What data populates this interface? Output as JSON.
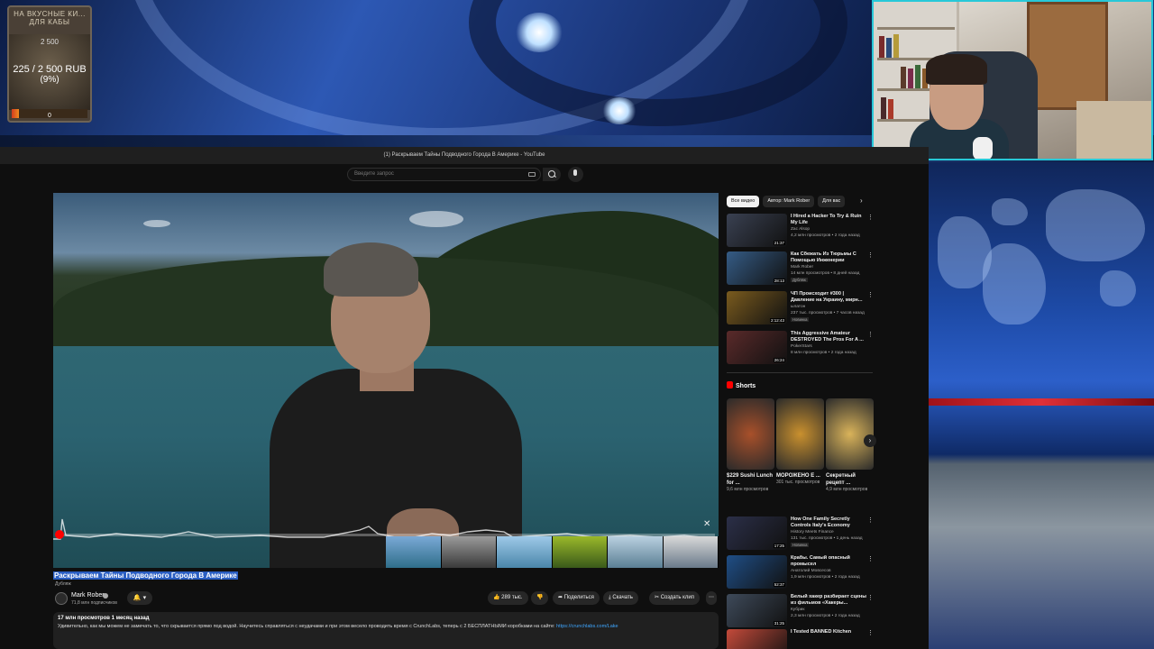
{
  "donation": {
    "header": "НА ВКУСНЫЕ КИ... ДЛЯ КАБЫ",
    "goal": "2 500",
    "amount": "225 / 2 500 RUB",
    "percent": "(9%)",
    "progress_fraction": 0.09,
    "bar_start": "0"
  },
  "browser": {
    "window_title": "(1) Раскрываем Тайны Подводного Города В Америке - YouTube"
  },
  "search": {
    "placeholder": "Введите запрос"
  },
  "video": {
    "title": "Раскрываем Тайны Подводного Города В Америке",
    "dubbed_label": "Дубляж",
    "progress_fraction": 0.01
  },
  "channel": {
    "name": "Mark Rober",
    "subscribers": "71,8 млн подписчиков"
  },
  "actions": {
    "likes": "289 тыс.",
    "share": "Поделиться",
    "download": "Скачать",
    "clip": "Создать клип",
    "more": "⋯"
  },
  "description": {
    "meta": "17 млн просмотров  1 месяц назад",
    "text": "Удивительно, как мы можем не замечать то, что скрывается прямо под водой. Научитесь справляться с неудачами и при этом весело проводить время с CrunchLabs, теперь с 2 БЕСПЛАТНЫМИ коробками на сайте: ",
    "link": "https://crunchlabs.com/Lake"
  },
  "chips": [
    "Все видео",
    "Автор: Mark Rober",
    "Для вас"
  ],
  "recommendations": [
    {
      "title": "I Hired a Hacker To Try & Ruin My Life",
      "channel": "Zac Alsop",
      "meta": "4,2 млн просмотров • 2 года назад",
      "duration": "21:37",
      "badge": "",
      "thumb_color": "#3a4152"
    },
    {
      "title": "Как Сбежать Из Тюрьмы С Помощью Инженерии",
      "channel": "Mark Rober",
      "meta": "14 млн просмотров • 8 дней назад",
      "duration": "28:13",
      "badge": "Дубляж",
      "thumb_color": "#355c86"
    },
    {
      "title": "ЧП Происходит #300 | Давление на Украину, мирн...",
      "channel": "ылатон",
      "meta": "237 тыс. просмотров • 7 часов назад",
      "duration": "2:12:43",
      "badge": "Новинка",
      "thumb_color": "#7a5b1e"
    },
    {
      "title": "This Aggressive Amateur DESTROYED The Pros For A ...",
      "channel": "PokerStars",
      "meta": "8 млн просмотров • 2 года назад",
      "duration": "26:24",
      "badge": "",
      "thumb_color": "#5a2a2a"
    }
  ],
  "shorts": {
    "heading": "Shorts",
    "items": [
      {
        "title": "$229 Sushi Lunch for ...",
        "views": "9,6 млн просмотров",
        "thumb_color": "#a8502a"
      },
      {
        "title": "МОРОЖЕНО Е ...",
        "views": "301 тыс. просмотров",
        "thumb_color": "#c9902e"
      },
      {
        "title": "Секретный рецепт ...",
        "views": "4,9 млн просмотров",
        "thumb_color": "#d9b35a"
      }
    ]
  },
  "recommendations_lower": [
    {
      "title": "How One Family Secretly Controls Italy's Economy",
      "channel": "History Meets Finance",
      "meta": "131 тыс. просмотров • 1 день назад",
      "duration": "17:25",
      "badge": "Новинка",
      "thumb_color": "#2b2f48"
    },
    {
      "title": "Крабы. Самый опасный промысел",
      "channel": "Анатолий Мовсесов",
      "meta": "1,9 млн просмотров • 2 года назад",
      "duration": "52:37",
      "badge": "",
      "thumb_color": "#1f4e86"
    },
    {
      "title": "Белый хакер разбирает сцены из фильмов «Хакеры...",
      "channel": "Кубрик",
      "meta": "2,3 млн просмотров • 2 года назад",
      "duration": "31:25",
      "badge": "",
      "thumb_color": "#3e4a5a"
    },
    {
      "title": "I Tested BANNED Kitchen",
      "channel": "",
      "meta": "",
      "duration": "",
      "badge": "",
      "thumb_color": "#c44a3a"
    }
  ]
}
